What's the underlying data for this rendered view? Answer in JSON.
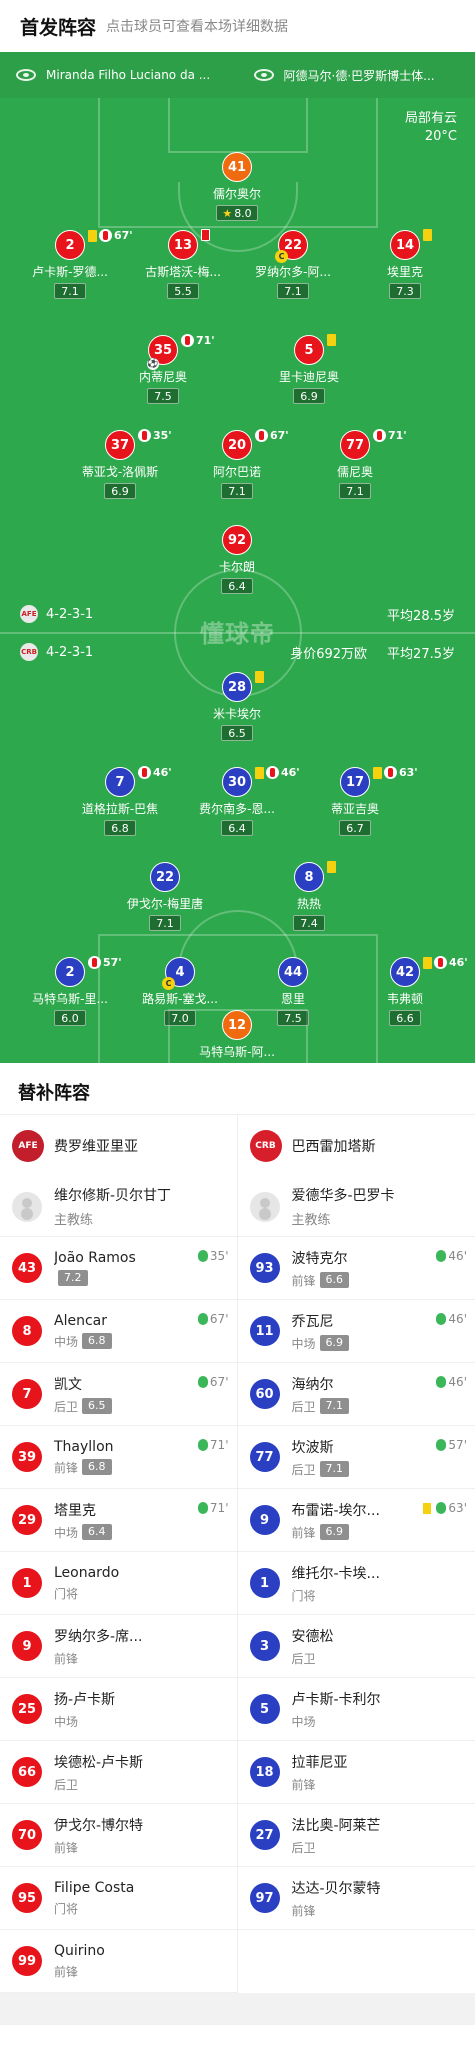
{
  "header": {
    "title": "首发阵容",
    "hint": "点击球员可查看本场详细数据"
  },
  "venue": {
    "stadium": "Miranda Filho Luciano da ...",
    "referee": "阿德马尔·德·巴罗斯博士体..."
  },
  "weather": {
    "condition": "局部有云",
    "temp": "20°C"
  },
  "home": {
    "formation": "4-2-3-1",
    "avg_age": "平均28.5岁",
    "players": [
      {
        "num": "41",
        "name": "儒尔奥尔",
        "rating": "8.0",
        "mvp": true,
        "color": "orange"
      },
      {
        "num": "2",
        "name": "卢卡斯-罗德...",
        "rating": "7.1",
        "yellow": true,
        "sub": "67'"
      },
      {
        "num": "13",
        "name": "古斯塔沃-梅...",
        "rating": "5.5",
        "red": true
      },
      {
        "num": "22",
        "name": "罗纳尔多-阿...",
        "rating": "7.1",
        "cap": true
      },
      {
        "num": "14",
        "name": "埃里克",
        "rating": "7.3",
        "yellow": true
      },
      {
        "num": "35",
        "name": "内蒂尼奥",
        "rating": "7.5",
        "sub": "71'",
        "goal": true
      },
      {
        "num": "5",
        "name": "里卡迪尼奥",
        "rating": "6.9",
        "yellow": true
      },
      {
        "num": "37",
        "name": "蒂亚戈-洛佩斯",
        "rating": "6.9",
        "sub": "35'"
      },
      {
        "num": "20",
        "name": "阿尔巴诺",
        "rating": "7.1",
        "sub": "67'"
      },
      {
        "num": "77",
        "name": "儒尼奥",
        "rating": "7.1",
        "sub": "71'"
      },
      {
        "num": "92",
        "name": "卡尔朗",
        "rating": "6.4"
      }
    ]
  },
  "away": {
    "formation": "4-2-3-1",
    "value": "身价692万欧",
    "avg_age": "平均27.5岁",
    "players": [
      {
        "num": "28",
        "name": "米卡埃尔",
        "rating": "6.5",
        "yellow": true
      },
      {
        "num": "7",
        "name": "道格拉斯-巴焦",
        "rating": "6.8",
        "sub": "46'"
      },
      {
        "num": "30",
        "name": "费尔南多-恩...",
        "rating": "6.4",
        "yellow": true,
        "sub": "46'"
      },
      {
        "num": "17",
        "name": "蒂亚吉奥",
        "rating": "6.7",
        "yellow": true,
        "sub": "63'"
      },
      {
        "num": "22",
        "name": "伊戈尔-梅里唐",
        "rating": "7.1"
      },
      {
        "num": "8",
        "name": "热热",
        "rating": "7.4",
        "yellow": true
      },
      {
        "num": "2",
        "name": "马特乌斯-里...",
        "rating": "6.0",
        "sub": "57'"
      },
      {
        "num": "4",
        "name": "路易斯-塞戈...",
        "rating": "7.0",
        "cap": true
      },
      {
        "num": "44",
        "name": "恩里",
        "rating": "7.5"
      },
      {
        "num": "42",
        "name": "韦弗顿",
        "rating": "6.6",
        "yellow": true,
        "sub": "46'"
      },
      {
        "num": "12",
        "name": "马特乌斯-阿...",
        "rating": "6.5",
        "color": "orange"
      }
    ]
  },
  "watermark": "懂球帝",
  "subs_title": "替补阵容",
  "home_team": {
    "name": "费罗维亚里亚",
    "crest": "AFE",
    "coach": {
      "name": "维尔修斯-贝尔甘丁",
      "role": "主教练"
    },
    "bench": [
      {
        "num": "43",
        "name": "João Ramos",
        "pos": "",
        "rating": "7.2",
        "in": "35'"
      },
      {
        "num": "8",
        "name": "Alencar",
        "pos": "中场",
        "rating": "6.8",
        "in": "67'"
      },
      {
        "num": "7",
        "name": "凯文",
        "pos": "后卫",
        "rating": "6.5",
        "in": "67'"
      },
      {
        "num": "39",
        "name": "Thayllon",
        "pos": "前锋",
        "rating": "6.8",
        "in": "71'"
      },
      {
        "num": "29",
        "name": "塔里克",
        "pos": "中场",
        "rating": "6.4",
        "in": "71'"
      },
      {
        "num": "1",
        "name": "Leonardo",
        "pos": "门将"
      },
      {
        "num": "9",
        "name": "罗纳尔多-席...",
        "pos": "前锋"
      },
      {
        "num": "25",
        "name": "扬-卢卡斯",
        "pos": "中场"
      },
      {
        "num": "66",
        "name": "埃德松-卢卡斯",
        "pos": "后卫"
      },
      {
        "num": "70",
        "name": "伊戈尔-博尔特",
        "pos": "前锋"
      },
      {
        "num": "95",
        "name": "Filipe Costa",
        "pos": "门将"
      },
      {
        "num": "99",
        "name": "Quirino",
        "pos": "前锋"
      }
    ]
  },
  "away_team": {
    "name": "巴西雷加塔斯",
    "crest": "CRB",
    "coach": {
      "name": "爱德华多-巴罗卡",
      "role": "主教练"
    },
    "bench": [
      {
        "num": "93",
        "name": "波特克尔",
        "pos": "前锋",
        "rating": "6.6",
        "in": "46'"
      },
      {
        "num": "11",
        "name": "乔瓦尼",
        "pos": "中场",
        "rating": "6.9",
        "in": "46'"
      },
      {
        "num": "60",
        "name": "海纳尔",
        "pos": "后卫",
        "rating": "7.1",
        "in": "46'"
      },
      {
        "num": "77",
        "name": "坎波斯",
        "pos": "后卫",
        "rating": "7.1",
        "in": "57'"
      },
      {
        "num": "9",
        "name": "布雷诺-埃尔...",
        "pos": "前锋",
        "rating": "6.9",
        "in": "63'",
        "yellow": true
      },
      {
        "num": "1",
        "name": "维托尔-卡埃...",
        "pos": "门将"
      },
      {
        "num": "3",
        "name": "安德松",
        "pos": "后卫"
      },
      {
        "num": "5",
        "name": "卢卡斯-卡利尔",
        "pos": "中场"
      },
      {
        "num": "18",
        "name": "拉菲尼亚",
        "pos": "前锋"
      },
      {
        "num": "27",
        "name": "法比奥-阿莱芒",
        "pos": "后卫"
      },
      {
        "num": "97",
        "name": "达达-贝尔蒙特",
        "pos": "前锋"
      }
    ]
  },
  "colors": {
    "home": "#e8141c",
    "away": "#2a3fc2",
    "gk": "#f06a0f",
    "pitch": "#2ea84c"
  }
}
